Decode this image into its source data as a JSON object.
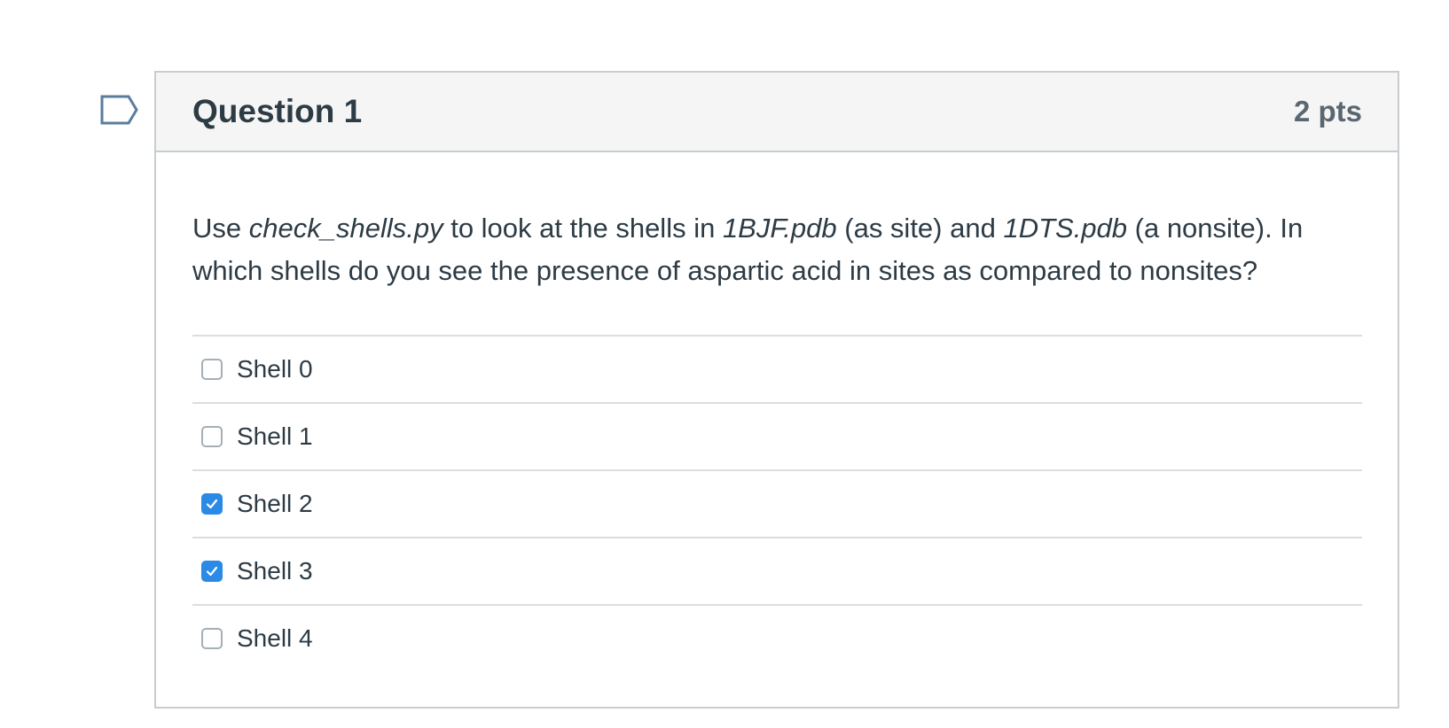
{
  "question": {
    "title": "Question 1",
    "points": "2 pts",
    "text_parts": [
      {
        "text": "Use ",
        "italic": false
      },
      {
        "text": "check_shells.py",
        "italic": true
      },
      {
        "text": " to look at the shells in ",
        "italic": false
      },
      {
        "text": "1BJF.pdb",
        "italic": true
      },
      {
        "text": " (as site) and ",
        "italic": false
      },
      {
        "text": "1DTS.pdb",
        "italic": true
      },
      {
        "text": " (a nonsite). In which shells do you see the presence of aspartic acid in sites as compared to nonsites?",
        "italic": false
      }
    ],
    "answers": [
      {
        "label": "Shell 0",
        "checked": false
      },
      {
        "label": "Shell 1",
        "checked": false
      },
      {
        "label": "Shell 2",
        "checked": true
      },
      {
        "label": "Shell 3",
        "checked": true
      },
      {
        "label": "Shell 4",
        "checked": false
      }
    ]
  },
  "colors": {
    "checkbox_checked": "#2b8ae6",
    "header_background": "#f5f5f5",
    "flag_outline": "#5a7d9e"
  },
  "icons": {
    "flag": "flag-question-icon",
    "check": "check-icon"
  }
}
